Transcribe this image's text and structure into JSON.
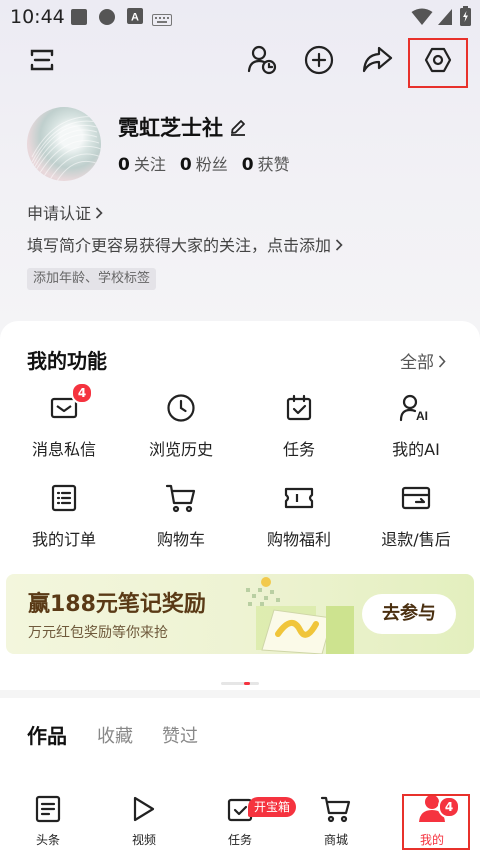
{
  "status_bar": {
    "time": "10:44",
    "icons": [
      "square-icon",
      "circle-icon",
      "a-box-icon",
      "keyboard-icon",
      "wifi-icon",
      "signal-icon",
      "battery-charging-icon"
    ]
  },
  "top_bar": {
    "icons": [
      "menu-icon",
      "friends-icon",
      "add-icon",
      "share-icon",
      "settings-icon"
    ]
  },
  "profile": {
    "nickname": "霓虹芝士社",
    "stats": [
      {
        "count": "0",
        "label": "关注"
      },
      {
        "count": "0",
        "label": "粉丝"
      },
      {
        "count": "0",
        "label": "获赞"
      }
    ],
    "verify_label": "申请认证",
    "bio_prompt": "填写简介更容易获得大家的关注，点击添加",
    "tag_label": "添加年龄、学校标签"
  },
  "functions": {
    "title": "我的功能",
    "more_label": "全部",
    "items": [
      {
        "label": "消息私信",
        "icon": "message-icon",
        "badge": "4"
      },
      {
        "label": "浏览历史",
        "icon": "clock-icon"
      },
      {
        "label": "任务",
        "icon": "calendar-check-icon"
      },
      {
        "label": "我的AI",
        "icon": "ai-person-icon"
      },
      {
        "label": "我的订单",
        "icon": "order-list-icon"
      },
      {
        "label": "购物车",
        "icon": "cart-icon"
      },
      {
        "label": "购物福利",
        "icon": "ticket-icon"
      },
      {
        "label": "退款/售后",
        "icon": "refund-card-icon"
      }
    ]
  },
  "banner": {
    "title": "赢188元笔记奖励",
    "subtitle": "万元红包奖励等你来抢",
    "button_label": "去参与"
  },
  "content_tabs": [
    "作品",
    "收藏",
    "赞过"
  ],
  "bottom_nav": {
    "items": [
      {
        "label": "头条",
        "icon": "headline-icon"
      },
      {
        "label": "视频",
        "icon": "play-icon"
      },
      {
        "label": "任务",
        "icon": "task-icon",
        "pill": "开宝箱"
      },
      {
        "label": "商城",
        "icon": "cart-icon"
      },
      {
        "label": "我的",
        "icon": "profile-icon",
        "badge": "4"
      }
    ]
  },
  "colors": {
    "accent_red": "#f5333f",
    "highlight_box": "#e8312b"
  }
}
